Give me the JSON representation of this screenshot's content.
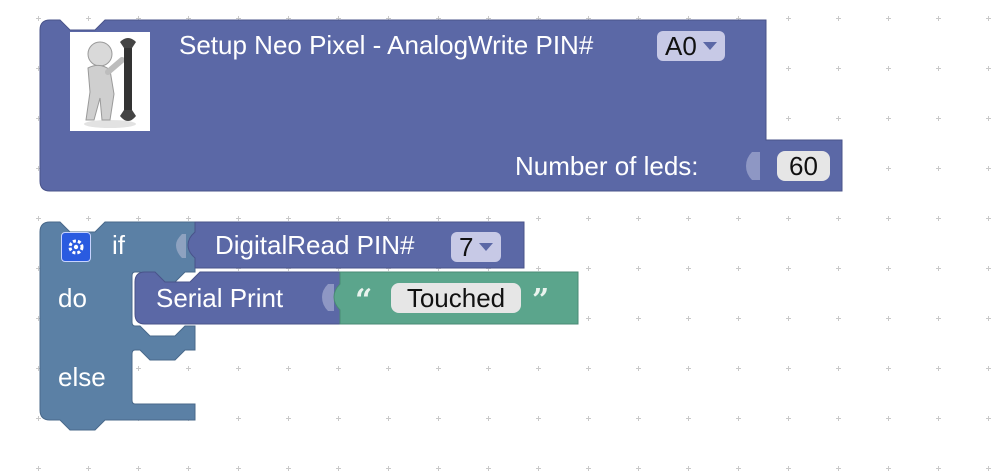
{
  "colors": {
    "neopixel_block": "#5b68a6",
    "if_block": "#5b80a5",
    "text_block": "#5ba58c",
    "grid": "#c9c9c9"
  },
  "setup_block": {
    "label": "Setup Neo Pixel - AnalogWrite PIN#",
    "pin_value": "A0",
    "leds_label": "Number of leds:",
    "leds_value": "60",
    "image_icon": "wrench-person-icon"
  },
  "if_block": {
    "if_label": "if",
    "do_label": "do",
    "else_label": "else",
    "mutator_icon": "gear-icon",
    "condition": {
      "label": "DigitalRead PIN#",
      "pin_value": "7"
    },
    "do_statement": {
      "label": "Serial Print",
      "text_value": "Touched",
      "open_quote": "“",
      "close_quote": "”"
    }
  }
}
